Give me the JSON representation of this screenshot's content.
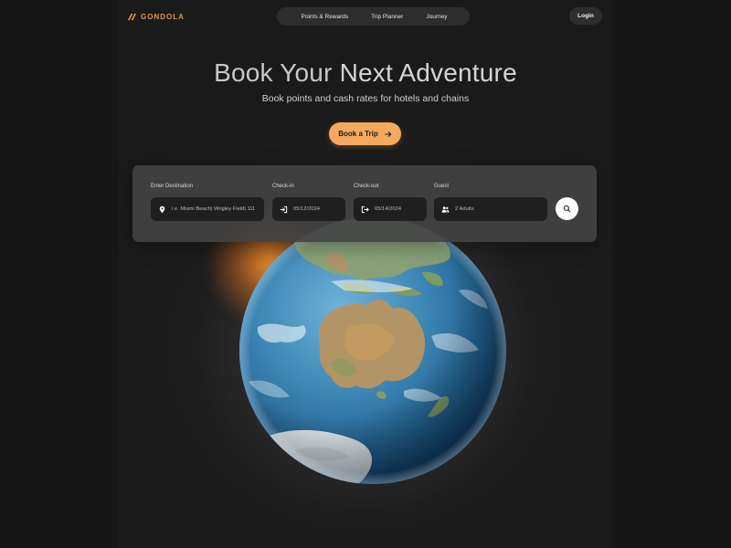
{
  "brand": {
    "name": "GONDOLA",
    "logo_icon": "gondola-logo-icon",
    "accent": "#e0944a"
  },
  "nav": {
    "items": [
      {
        "label": "Points & Rewards"
      },
      {
        "label": "Trip Planner"
      },
      {
        "label": "Journey"
      }
    ],
    "login_label": "Login"
  },
  "hero": {
    "title_part1": "Book Your ",
    "title_part2": "Next Adventure",
    "subtitle": "Book points and cash rates for hotels and chains",
    "cta_label": "Book a Trip",
    "cta_icon": "arrow-right-icon",
    "cta_color": "#f4a95e"
  },
  "search": {
    "destination": {
      "label": "Enter Destination",
      "value": "i.e. Miami Beach| Wrigley Field| 111 M",
      "icon": "map-pin-icon"
    },
    "checkin": {
      "label": "Check-in",
      "value": "05/12/2024",
      "icon": "login-arrow-icon"
    },
    "checkout": {
      "label": "Check-out",
      "value": "05/14/2024",
      "icon": "logout-arrow-icon"
    },
    "guest": {
      "label": "Guest",
      "value": "2 Adults",
      "icon": "users-icon"
    },
    "submit_icon": "search-icon"
  }
}
